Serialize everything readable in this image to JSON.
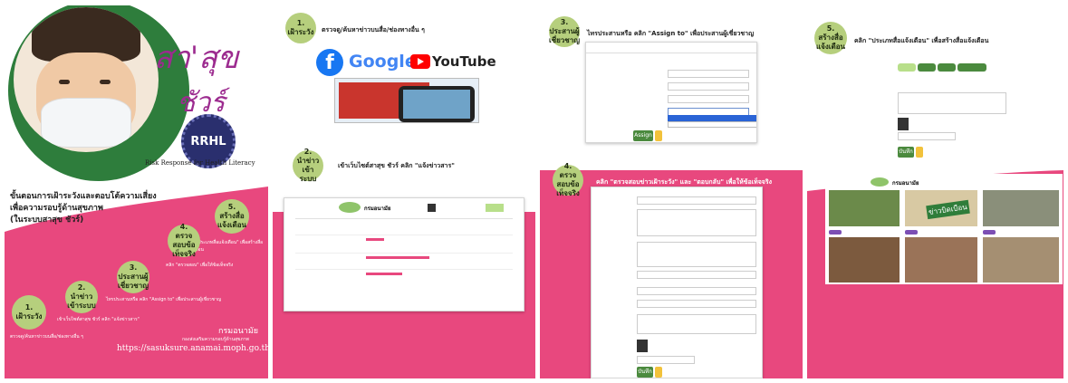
{
  "panel1": {
    "brand_top": "สา'สุข",
    "brand_bottom": "ชัวร์",
    "rrhl": "RRHL",
    "rrhl_caption": "Risk Response for Health Literacy",
    "title_line1": "ขั้นตอนการเฝ้าระวังและตอบโต้ความเสี่ยง",
    "title_line2": "เพื่อความรอบรู้ด้านสุขภาพ",
    "title_line3": "(ในระบบสาสุข ชัวร์)",
    "steps": [
      {
        "num": "1.",
        "label": "เฝ้าระวัง",
        "desc": "ตรวจดู/ค้นหาข่าวบนสื่อ/ช่องทางอื่น ๆ"
      },
      {
        "num": "2.",
        "label": "นำข่าวเข้าระบบ",
        "desc": "เข้าเว็บไซต์สาสุข ชัวร์ คลิก \"แจ้งข่าวสาร\""
      },
      {
        "num": "3.",
        "label": "ประสานผู้เชี่ยวชาญ",
        "desc": "ไทรประสานหรือ คลิก \"Assign to\" เพื่อประสานผู้เชี่ยวชาญ"
      },
      {
        "num": "4.",
        "label": "ตรวจสอบข้อเท็จจริง",
        "desc": "คลิก \"ตรวจสอบ\" เพื่อให้ข้อเท็จจริง"
      },
      {
        "num": "5.",
        "label": "สร้างสื่อแจ้งเตือน",
        "desc": "คลิก \"ประเภทสื่อแจ้งเตือน\" เพื่อสร้างสื่อแจ้งเตือน"
      }
    ],
    "org": "กรมอนามัย",
    "org_sub": "กองส่งเสริมความรอบรู้ด้านสุขภาพ",
    "url": "https://sasuksure.anamai.moph.go.th/"
  },
  "panel2": {
    "step1_num": "1.",
    "step1_label": "เฝ้าระวัง",
    "step1_text": "ตรวจดู/ค้นหาข่าวบนสื่อ/ช่องทางอื่น ๆ",
    "google": "Google",
    "youtube": "YouTube",
    "step2_num": "2.",
    "step2_label": "นำข่าวเข้าระบบ",
    "step2_text": "เข้าเว็บไซต์สาสุข ชัวร์ คลิก \"แจ้งข่าวสาร\"",
    "site_brand": "กรมอนามัย"
  },
  "panel3": {
    "step3_num": "3.",
    "step3_label": "ประสานผู้เชี่ยวชาญ",
    "step3_text": "ไทรประสานหรือ คลิก \"Assign to\" เพื่อประสานผู้เชี่ยวชาญ",
    "assign_btn": "Assign",
    "step4_num": "4.",
    "step4_label": "ตรวจสอบข้อเท็จจริง",
    "step4_text": "คลิก \"ตรวจสอบข่าวเฝ้าระวัง\" และ \"ตอบกลับ\" เพื่อให้ข้อเท็จจริง",
    "save_btn": "บันทึก"
  },
  "panel4": {
    "step5_num": "5.",
    "step5_label": "สร้างสื่อแจ้งเตือน",
    "step5_text": "คลิก \"ประเภทสื่อแจ้งเตือน\" เพื่อสร้างสื่อแจ้งเตือน",
    "save_btn": "บันทึก",
    "site_brand": "กรมอนามัย",
    "stamp": "ข่าวบิดเบือน"
  },
  "colors": {
    "pink": "#e8487e",
    "green": "#b6cf7d",
    "darkgreen": "#2f7d3a"
  }
}
